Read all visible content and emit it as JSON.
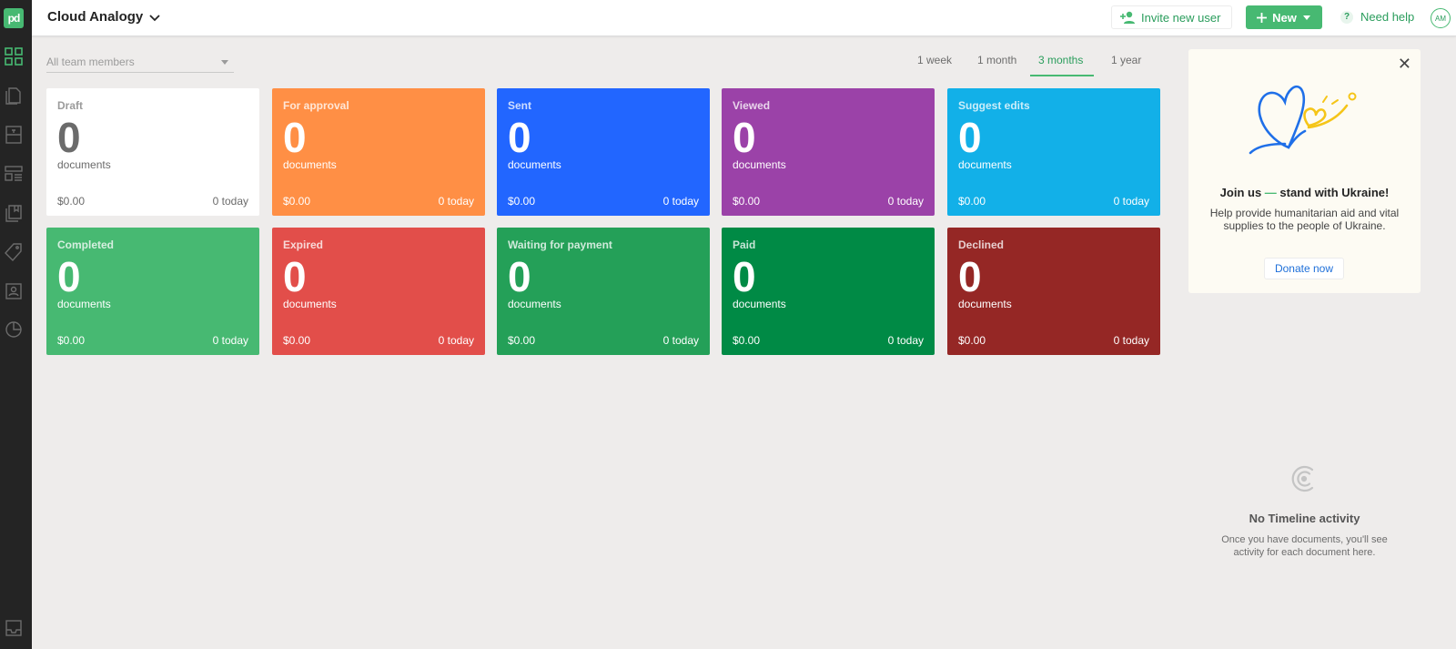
{
  "header": {
    "workspace": "Cloud Analogy",
    "invite_label": "Invite new user",
    "new_label": "New",
    "help_label": "Need help",
    "avatar_initials": "AM"
  },
  "filter": {
    "team_placeholder": "All team members",
    "periods": [
      "1 week",
      "1 month",
      "3 months",
      "1 year"
    ],
    "active_period": "3 months"
  },
  "cards": [
    {
      "title": "Draft",
      "count": "0",
      "unit": "documents",
      "amount": "$0.00",
      "today": "0 today",
      "color": "#ffffff"
    },
    {
      "title": "For approval",
      "count": "0",
      "unit": "documents",
      "amount": "$0.00",
      "today": "0 today",
      "color": "#ff8f45"
    },
    {
      "title": "Sent",
      "count": "0",
      "unit": "documents",
      "amount": "$0.00",
      "today": "0 today",
      "color": "#2266ff"
    },
    {
      "title": "Viewed",
      "count": "0",
      "unit": "documents",
      "amount": "$0.00",
      "today": "0 today",
      "color": "#9b42a8"
    },
    {
      "title": "Suggest edits",
      "count": "0",
      "unit": "documents",
      "amount": "$0.00",
      "today": "0 today",
      "color": "#12b0e8"
    },
    {
      "title": "Completed",
      "count": "0",
      "unit": "documents",
      "amount": "$0.00",
      "today": "0 today",
      "color": "#47b972"
    },
    {
      "title": "Expired",
      "count": "0",
      "unit": "documents",
      "amount": "$0.00",
      "today": "0 today",
      "color": "#e24e4a"
    },
    {
      "title": "Waiting for payment",
      "count": "0",
      "unit": "documents",
      "amount": "$0.00",
      "today": "0 today",
      "color": "#24a058"
    },
    {
      "title": "Paid",
      "count": "0",
      "unit": "documents",
      "amount": "$0.00",
      "today": "0 today",
      "color": "#008a45"
    },
    {
      "title": "Declined",
      "count": "0",
      "unit": "documents",
      "amount": "$0.00",
      "today": "0 today",
      "color": "#952725"
    }
  ],
  "ukraine": {
    "heading_a": "Join us ",
    "heading_dash": "—",
    "heading_b": " stand with Ukraine!",
    "text": "Help provide humanitarian aid and vital supplies to the people of Ukraine.",
    "donate_label": "Donate now"
  },
  "timeline": {
    "title": "No Timeline activity",
    "text": "Once you have documents, you'll see activity for each document here."
  },
  "sidebar": {
    "icons": [
      "dashboard-icon",
      "documents-icon",
      "templates-icon",
      "content-library-icon",
      "forms-icon",
      "catalog-icon",
      "contacts-icon",
      "reports-icon",
      "inbox-icon"
    ]
  }
}
